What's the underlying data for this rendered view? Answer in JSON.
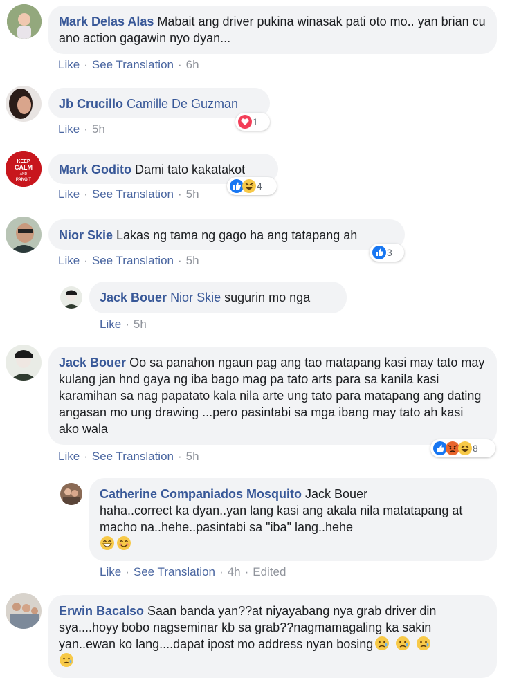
{
  "actions": {
    "like": "Like",
    "translate": "See Translation",
    "separator": "·",
    "edited": "Edited"
  },
  "comments": [
    {
      "author": "Mark Delas Alas",
      "text": "Mabait ang driver pukina winasak pati oto mo.. yan brian cu ano action gagawin nyo dyan...",
      "time": "6h"
    },
    {
      "author": "Jb Crucillo",
      "mention": "Camille De Guzman",
      "time": "5h",
      "reaction_icons": [
        "heart-react-icon"
      ],
      "reaction_count": "1"
    },
    {
      "author": "Mark Godito",
      "avatar_text": [
        "KEEP",
        "CALM",
        "AND",
        "PANGIT"
      ],
      "text": "Dami tato kakatakot",
      "time": "5h",
      "reaction_icons": [
        "like-react-icon",
        "haha-react-icon"
      ],
      "reaction_count": "4"
    },
    {
      "author": "Nior Skie",
      "text": "Lakas ng tama ng gago ha ang tatapang ah",
      "time": "5h",
      "reaction_icons": [
        "like-react-icon"
      ],
      "reaction_count": "3"
    },
    {
      "author": "Jack Bouer",
      "mention": "Nior Skie",
      "text": "sugurin mo nga",
      "time": "5h"
    },
    {
      "author": "Jack Bouer",
      "text": "Oo sa panahon ngaun pag ang tao matapang kasi may tato may kulang jan hnd gaya ng iba bago mag pa tato arts para sa kanila kasi karamihan sa nag papatato kala nila arte ung tato para matapang ang dating angasan mo ung drawing ...pero pasintabi sa mga ibang may tato ah kasi ako wala",
      "time": "5h",
      "reaction_icons": [
        "like-react-icon",
        "angry-react-icon",
        "haha-react-icon"
      ],
      "reaction_count": "8"
    },
    {
      "author": "Catherine Companiados Mosquito",
      "mention": "Jack Bouer",
      "text": "haha..correct ka dyan..yan lang kasi ang akala nila matatapang at macho na..hehe..pasintabi sa \"iba\" lang..hehe",
      "time": "4h",
      "emojis": [
        "grinning-emoji-icon",
        "smiling-emoji-icon"
      ]
    },
    {
      "author": "Erwin Bacalso",
      "text": "Saan banda yan??at niyayabang nya grab driver din sya....hoyy bobo nagseminar kb sa grab??nagmamagaling ka sakin yan..ewan ko lang....dapat ipost mo address nyan bosing",
      "emojis": [
        "sad-emoji-icon",
        "sad-emoji-icon",
        "sad-emoji-icon",
        "sad-emoji-icon"
      ]
    }
  ],
  "colors": {
    "link": "#385898",
    "bubble": "#f2f3f5",
    "meta": "#90949c",
    "like_blue": "#1877f2",
    "heart_red": "#f33e58",
    "emoji_yellow": "#f7c948"
  }
}
